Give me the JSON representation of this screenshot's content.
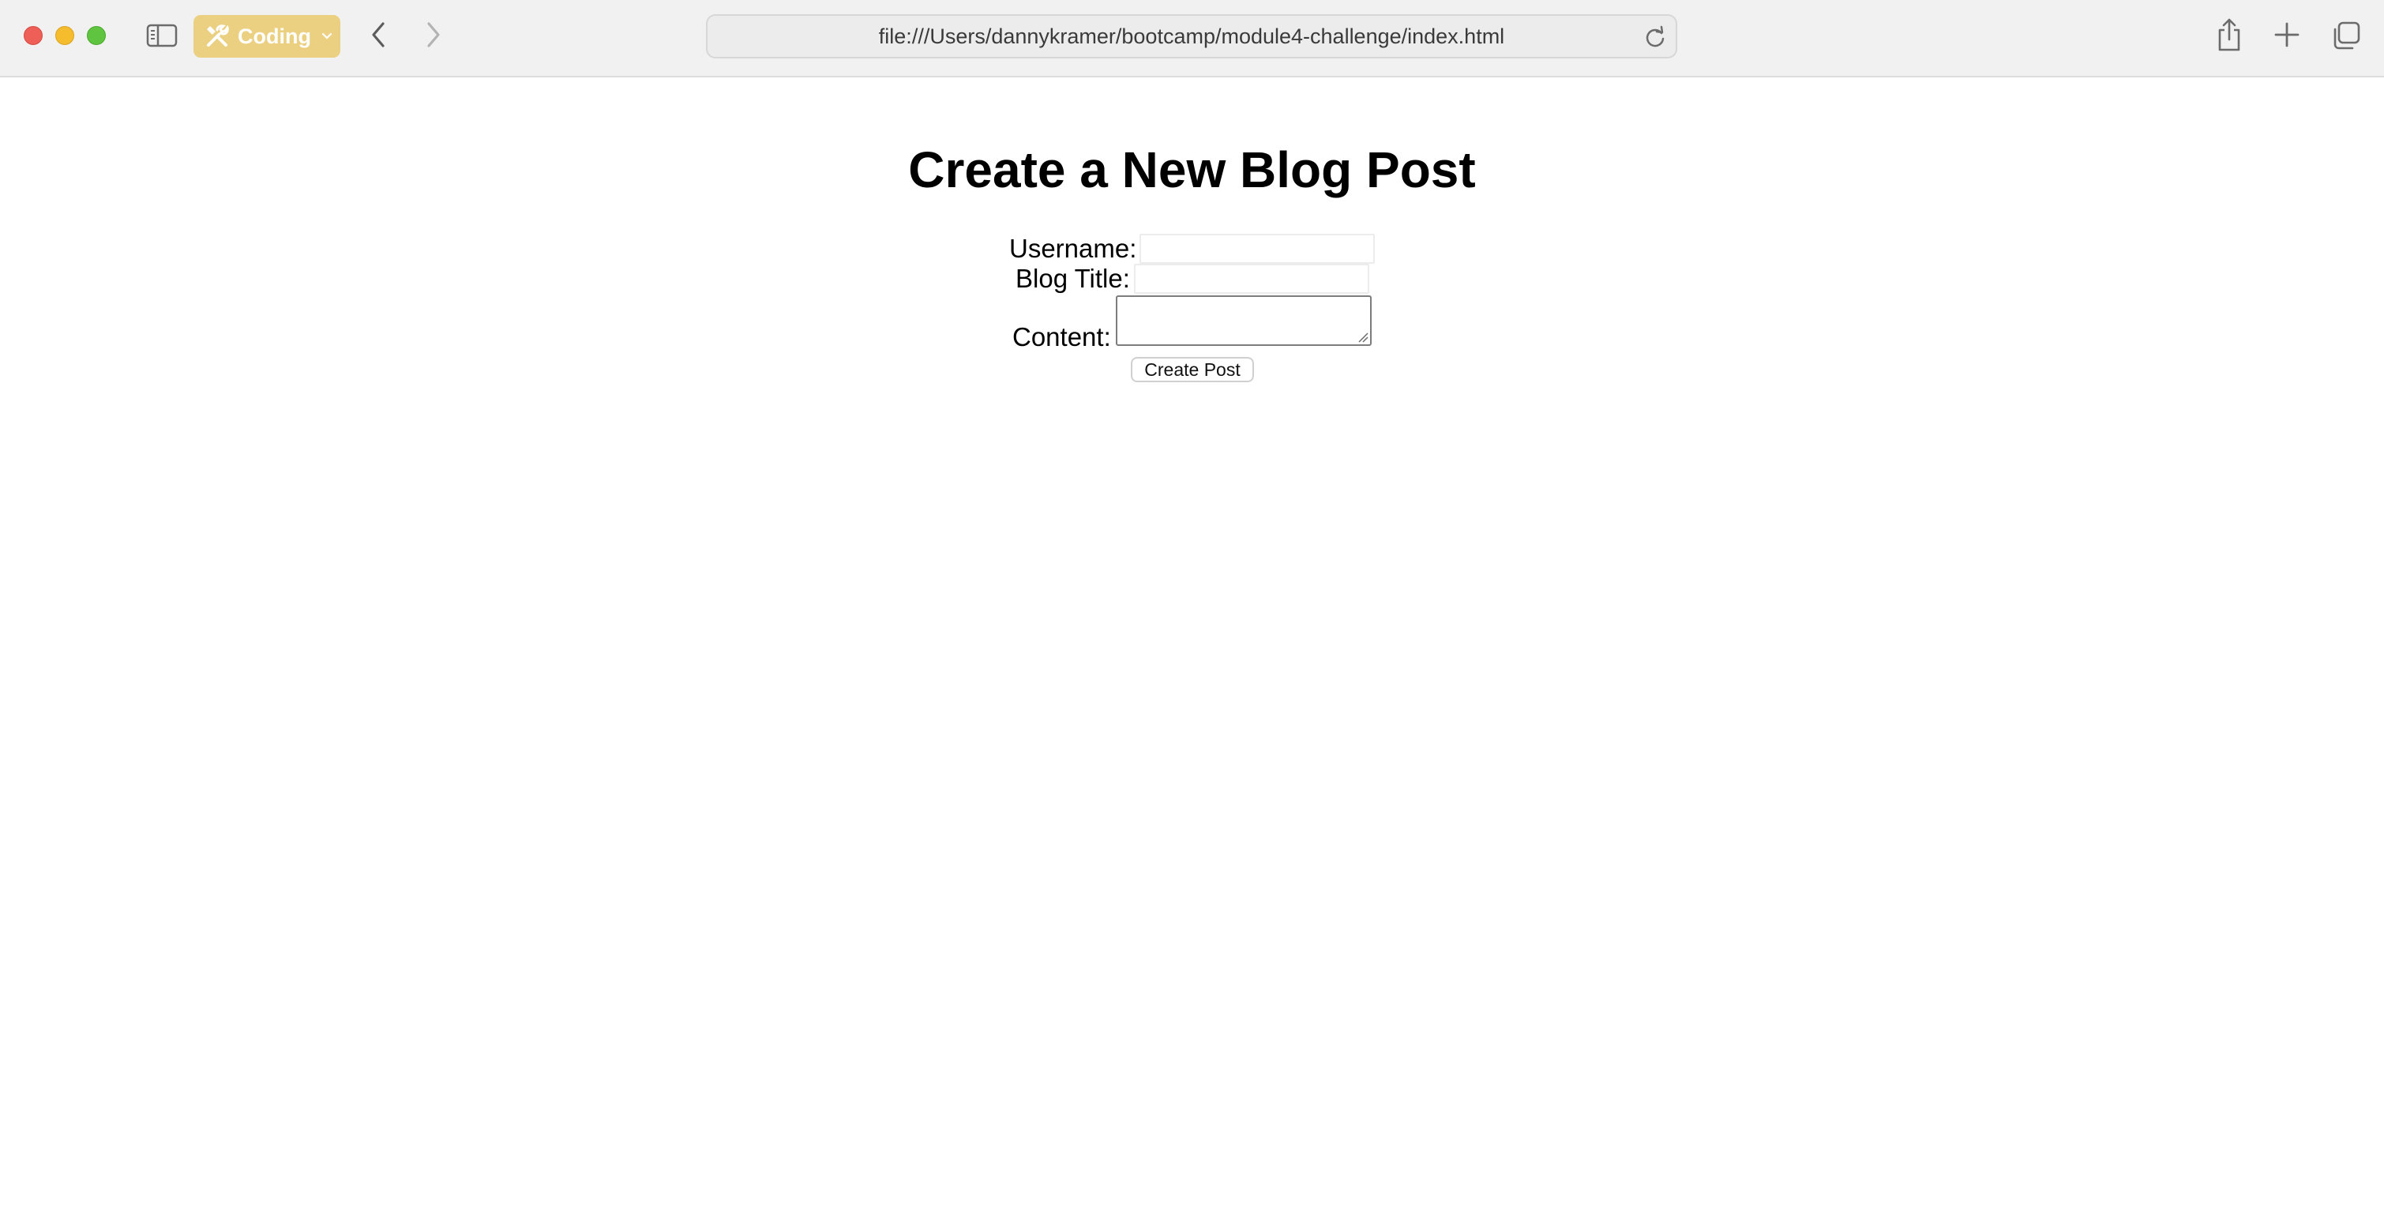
{
  "browser": {
    "profile": {
      "label": "Coding",
      "icon": "tools-icon",
      "color": "#ecd082"
    },
    "address": "file:///Users/dannykramer/bootcamp/module4-challenge/index.html",
    "icons": {
      "sidebar": "sidebar-icon",
      "back": "chevron-left-icon",
      "forward": "chevron-right-icon",
      "reload": "reload-icon",
      "share": "share-icon",
      "new_tab": "plus-icon",
      "tabs": "tab-overview-icon"
    },
    "traffic_lights": {
      "close": "#ee5f57",
      "minimize": "#f5bd2e",
      "maximize": "#5fc43f"
    }
  },
  "page": {
    "title": "Create a New Blog Post",
    "form": {
      "username_label": "Username:",
      "blog_title_label": "Blog Title:",
      "content_label": "Content:",
      "username_value": "",
      "blog_title_value": "",
      "content_value": "",
      "submit_label": "Create Post"
    }
  }
}
